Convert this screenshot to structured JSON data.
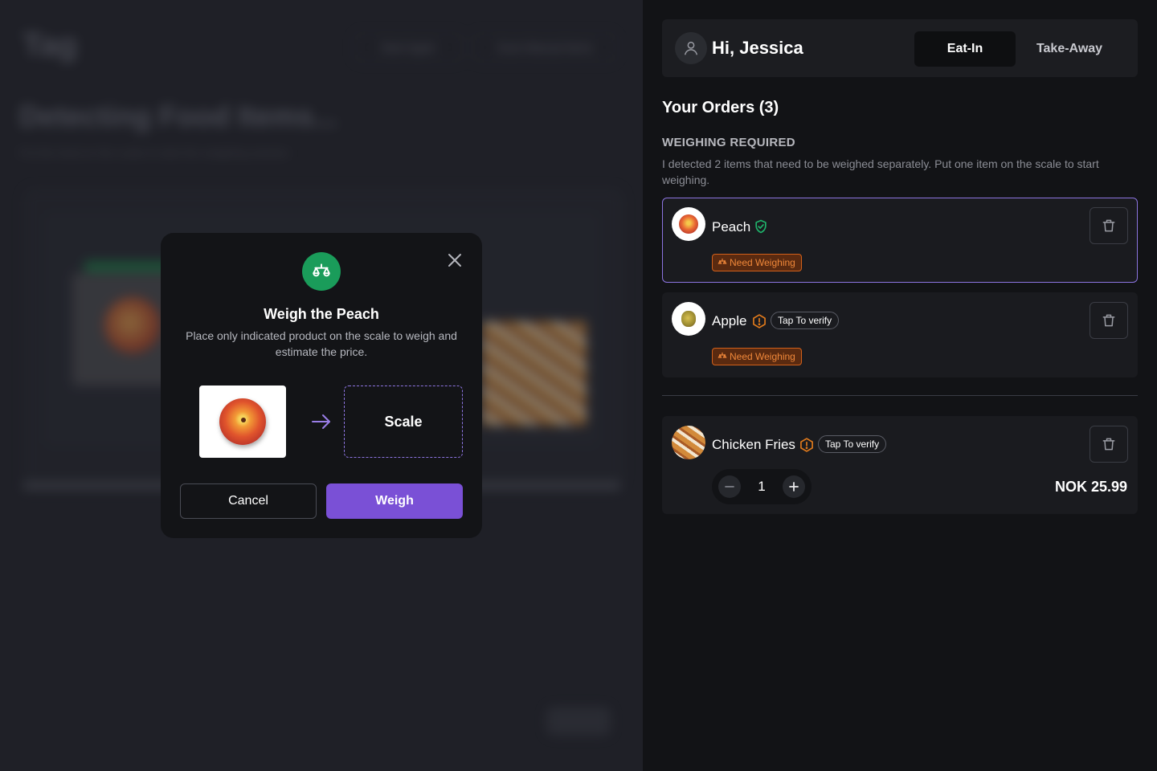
{
  "background": {
    "logo": "Tag",
    "pill_left": "Start Again",
    "pill_right": "Scan Manual Items",
    "title": "Detecting Food Items...",
    "subtitle": "Put the food on the scale to start the weighing session"
  },
  "modal": {
    "title": "Weigh the Peach",
    "description": "Place only indicated product on the scale to weigh and estimate the price.",
    "scale_label": "Scale",
    "cancel_label": "Cancel",
    "weigh_label": "Weigh",
    "icon": "scale-icon"
  },
  "header": {
    "greeting": "Hi, Jessica",
    "mode_eat_in": "Eat-In",
    "mode_take_away": "Take-Away",
    "selected_mode": "Eat-In"
  },
  "orders": {
    "title": "Your Orders (3)",
    "weighing_heading": "WEIGHING REQUIRED",
    "weighing_desc": "I detected 2 items that need to be weighed separately. Put one item on the scale to start weighing.",
    "items": [
      {
        "name": "Peach",
        "status": "verified",
        "badge": "Need Weighing",
        "selected": true
      },
      {
        "name": "Apple",
        "status": "unverified",
        "verify_label": "Tap To verify",
        "badge": "Need Weighing"
      },
      {
        "name": "Chicken Fries",
        "status": "unverified",
        "verify_label": "Tap To verify",
        "quantity": "1",
        "price": "NOK 25.99"
      }
    ]
  },
  "colors": {
    "accent": "#7a50d6",
    "success": "#1a9c5a",
    "warning": "#e07a1c"
  }
}
